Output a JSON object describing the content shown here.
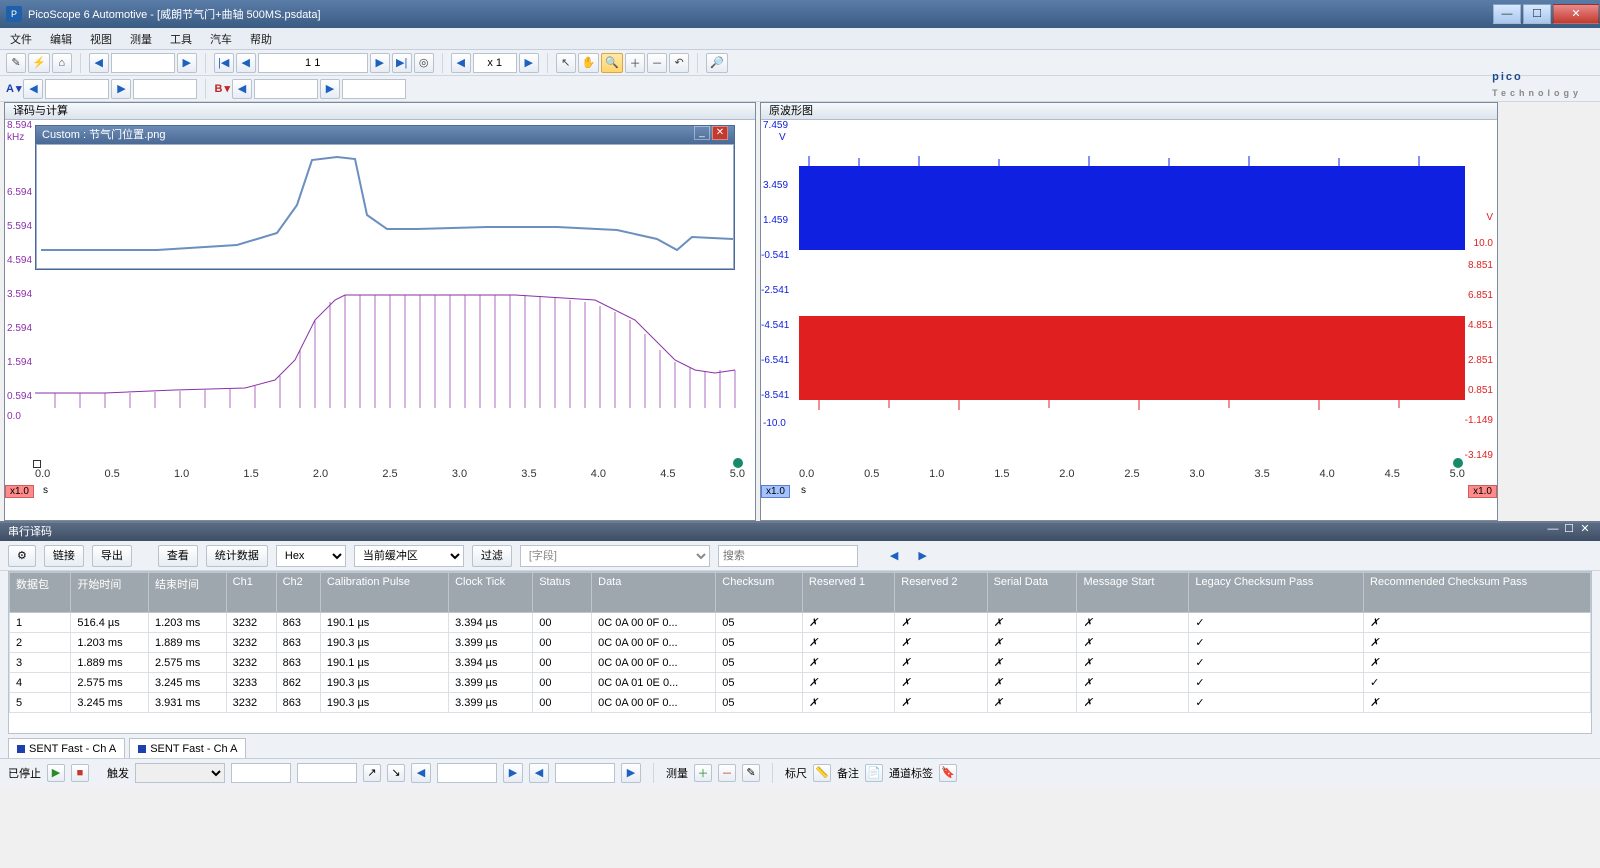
{
  "title": "PicoScope 6 Automotive - [威朗节气门+曲轴 500MS.psdata]",
  "menu": {
    "file": "文件",
    "edit": "编辑",
    "view": "视图",
    "measure": "测量",
    "tool": "工具",
    "auto": "汽车",
    "help": "帮助"
  },
  "toolbar": {
    "page_val": "1 1",
    "zoom_val": "x 1"
  },
  "chan": {
    "a": "A",
    "b": "B"
  },
  "pico": {
    "brand": "pico",
    "tag": "Technology"
  },
  "panel_left": "译码与计算",
  "panel_right": "原波形图",
  "floatwin_title": "Custom : 节气门位置.png",
  "left_axis_unit": "kHz",
  "left_axis_ticks": [
    "8.594",
    "6.594",
    "5.594",
    "4.594",
    "3.594",
    "2.594",
    "1.594",
    "0.594",
    "0.0"
  ],
  "x_axis_ticks": [
    "0.0",
    "0.5",
    "1.0",
    "1.5",
    "2.0",
    "2.5",
    "3.0",
    "3.5",
    "4.0",
    "4.5",
    "5.0"
  ],
  "x_unit": "s",
  "zoom_badge": "x1.0",
  "right_axis_unit": "V",
  "right_left_ticks": [
    "7.459",
    "3.459",
    "1.459",
    "-0.541",
    "-2.541",
    "-4.541",
    "-6.541",
    "-8.541",
    "-10.0"
  ],
  "right_right_ticks": [
    "V",
    "10.0",
    "8.851",
    "6.851",
    "4.851",
    "2.851",
    "0.851",
    "-1.149",
    "-3.149"
  ],
  "serial_title": "串行译码",
  "serial_tb": {
    "link": "链接",
    "export": "导出",
    "view": "查看",
    "stats": "统计数据",
    "fmt": "Hex",
    "buf": "当前缓冲区",
    "filter": "过滤",
    "field_ph": "[字段]",
    "search_ph": "搜索"
  },
  "columns": [
    "数据包",
    "开始时间",
    "结束时间",
    "Ch1",
    "Ch2",
    "Calibration Pulse",
    "Clock Tick",
    "Status",
    "Data",
    "Checksum",
    "Reserved 1",
    "Reserved 2",
    "Serial Data",
    "Message Start",
    "Legacy Checksum Pass",
    "Recommended Checksum Pass"
  ],
  "rows": [
    {
      "n": "1",
      "st": "516.4 µs",
      "et": "1.203 ms",
      "c1": "3232",
      "c2": "863",
      "cp": "190.1 µs",
      "ct": "3.394 µs",
      "stat": "00",
      "data": "0C 0A 00 0F 0...",
      "cs": "05",
      "r1": "✗",
      "r2": "✗",
      "sd": "✗",
      "ms": "✗",
      "lp": "✓",
      "rp": "✗"
    },
    {
      "n": "2",
      "st": "1.203 ms",
      "et": "1.889 ms",
      "c1": "3232",
      "c2": "863",
      "cp": "190.3 µs",
      "ct": "3.399 µs",
      "stat": "00",
      "data": "0C 0A 00 0F 0...",
      "cs": "05",
      "r1": "✗",
      "r2": "✗",
      "sd": "✗",
      "ms": "✗",
      "lp": "✓",
      "rp": "✗"
    },
    {
      "n": "3",
      "st": "1.889 ms",
      "et": "2.575 ms",
      "c1": "3232",
      "c2": "863",
      "cp": "190.1 µs",
      "ct": "3.394 µs",
      "stat": "00",
      "data": "0C 0A 00 0F 0...",
      "cs": "05",
      "r1": "✗",
      "r2": "✗",
      "sd": "✗",
      "ms": "✗",
      "lp": "✓",
      "rp": "✗"
    },
    {
      "n": "4",
      "st": "2.575 ms",
      "et": "3.245 ms",
      "c1": "3233",
      "c2": "862",
      "cp": "190.3 µs",
      "ct": "3.399 µs",
      "stat": "00",
      "data": "0C 0A 01 0E 0...",
      "cs": "05",
      "r1": "✗",
      "r2": "✗",
      "sd": "✗",
      "ms": "✗",
      "lp": "✓",
      "rp": "✓"
    },
    {
      "n": "5",
      "st": "3.245 ms",
      "et": "3.931 ms",
      "c1": "3232",
      "c2": "863",
      "cp": "190.3 µs",
      "ct": "3.399 µs",
      "stat": "00",
      "data": "0C 0A 00 0F 0...",
      "cs": "05",
      "r1": "✗",
      "r2": "✗",
      "sd": "✗",
      "ms": "✗",
      "lp": "✓",
      "rp": "✗"
    }
  ],
  "table_tabs": {
    "a": "SENT Fast - Ch A",
    "b": "SENT Fast - Ch A"
  },
  "bottom": {
    "stopped": "已停止",
    "trigger": "触发",
    "measure": "测量",
    "ruler": "标尺",
    "notes": "备注",
    "chanlabel": "通道标签"
  },
  "chart_data": [
    {
      "type": "line",
      "title": "节气门位置 (Custom inset)",
      "x": [
        0.0,
        1.0,
        1.5,
        1.8,
        2.0,
        2.1,
        2.3,
        2.5,
        3.0,
        4.0,
        4.5,
        4.7,
        5.0
      ],
      "values": [
        4.7,
        4.7,
        4.8,
        5.3,
        7.5,
        7.6,
        5.0,
        5.0,
        5.0,
        4.9,
        4.7,
        4.9,
        4.9
      ],
      "ylabel": "",
      "xlabel": "",
      "color": "#6b8fbf"
    },
    {
      "type": "line",
      "title": "译码与计算 kHz",
      "x": [
        0.0,
        0.5,
        1.0,
        1.5,
        1.8,
        2.0,
        2.2,
        3.0,
        3.5,
        4.0,
        4.5,
        4.7,
        5.0
      ],
      "values": [
        0.6,
        0.6,
        0.7,
        0.8,
        1.2,
        2.8,
        3.3,
        3.3,
        3.3,
        3.0,
        1.6,
        1.4,
        1.3
      ],
      "ylabel": "kHz",
      "xlabel": "s",
      "ylim": [
        0,
        8.594
      ],
      "color": "#8a2fa8"
    },
    {
      "type": "line",
      "title": "原波形图 Ch A (blue)",
      "ylabel": "V",
      "xlabel": "s",
      "xlim": [
        0,
        5
      ],
      "ylim": [
        -10,
        7.459
      ],
      "series_note": "dense waveform band between ~-0.54 V and ~3.46 V",
      "color": "#1020e0"
    },
    {
      "type": "line",
      "title": "原波形图 Ch B (red)",
      "ylabel": "V",
      "xlabel": "s",
      "xlim": [
        0,
        5
      ],
      "ylim": [
        -3.149,
        10.0
      ],
      "series_note": "dense waveform band between ~-8.54 V and ~-4.54 V on left axis",
      "color": "#e02020"
    }
  ]
}
